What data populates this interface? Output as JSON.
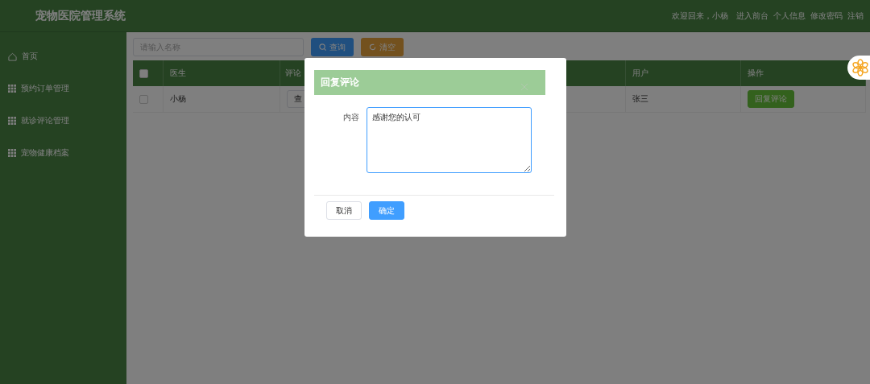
{
  "header": {
    "title": "宠物医院管理系统",
    "welcome": "欢迎回来，小杨",
    "links": [
      "进入前台",
      "个人信息",
      "修改密码",
      "注销"
    ]
  },
  "sidebar": {
    "items": [
      {
        "label": "首页",
        "kind": "home"
      },
      {
        "label": "预约订单管理",
        "kind": "grid"
      },
      {
        "label": "就诊评论管理",
        "kind": "grid"
      },
      {
        "label": "宠物健康档案",
        "kind": "grid"
      }
    ]
  },
  "toolbar": {
    "search": {
      "placeholder": "请输入名称"
    },
    "buttons": [
      {
        "label": "查询",
        "kind": "search"
      },
      {
        "label": "清空",
        "kind": "reset"
      }
    ]
  },
  "table": {
    "select_all": {
      "checked": false
    },
    "columns": [
      "医生",
      "评论",
      "用户",
      "操作"
    ],
    "rows": [
      {
        "checked": false,
        "doctor": "小杨",
        "comment_button": "查",
        "user": "张三",
        "action": "回复评论"
      }
    ]
  },
  "dialog": {
    "title": "回复评论",
    "field_label": "内容",
    "value": "感谢您的认可",
    "buttons": [
      {
        "label": "取消",
        "kind": "default"
      },
      {
        "label": "确定",
        "kind": "primary"
      }
    ]
  }
}
